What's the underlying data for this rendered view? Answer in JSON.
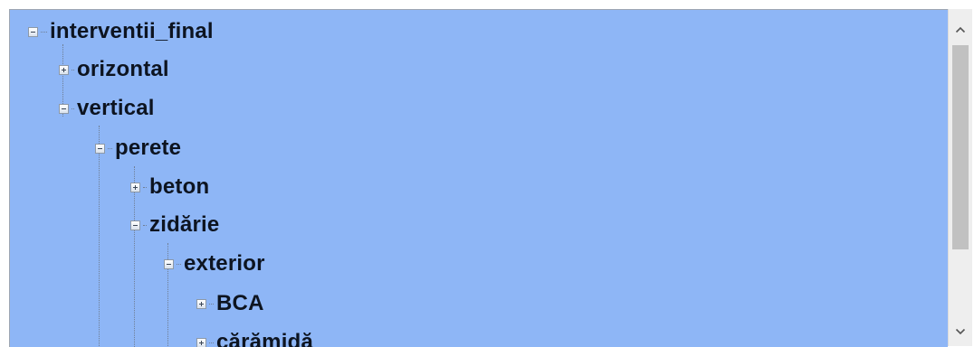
{
  "tree": {
    "nodes": [
      {
        "label": "interventii_final",
        "state": "expanded"
      },
      {
        "label": "orizontal",
        "state": "collapsed"
      },
      {
        "label": "vertical",
        "state": "expanded"
      },
      {
        "label": "perete",
        "state": "expanded"
      },
      {
        "label": "beton",
        "state": "collapsed"
      },
      {
        "label": "zidărie",
        "state": "expanded"
      },
      {
        "label": "exterior",
        "state": "expanded"
      },
      {
        "label": "BCA",
        "state": "collapsed"
      },
      {
        "label": "cărămidă",
        "state": "collapsed"
      }
    ]
  },
  "scrollbar": {
    "up_icon": "chevron-up-icon",
    "down_icon": "chevron-down-icon"
  },
  "colors": {
    "panel_background": "#8eb6f6",
    "scrollbar_track": "#eeeeee",
    "scrollbar_thumb": "#c1c1c1"
  }
}
